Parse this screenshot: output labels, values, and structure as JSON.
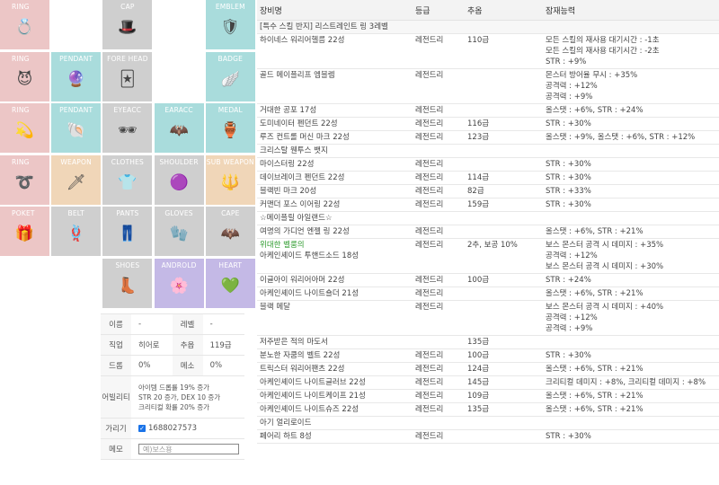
{
  "slots": [
    {
      "label": "RING",
      "icon": "ring-pink-icon",
      "glyph": "💍",
      "color": "p"
    },
    {
      "label": "",
      "icon": "",
      "glyph": "",
      "color": "blank"
    },
    {
      "label": "CAP",
      "icon": "cap-icon",
      "glyph": "🎩",
      "color": "g"
    },
    {
      "label": "",
      "icon": "",
      "glyph": "",
      "color": "blank"
    },
    {
      "label": "EMBLEM",
      "icon": "emblem-icon",
      "glyph": "🛡",
      "color": "t"
    },
    {
      "label": "RING",
      "icon": "ring-demon-icon",
      "glyph": "😈",
      "color": "p"
    },
    {
      "label": "PENDANT",
      "icon": "pendant-icon",
      "glyph": "🔮",
      "color": "t"
    },
    {
      "label": "FORE HEAD",
      "icon": "forehead-icon",
      "glyph": "🃏",
      "color": "g"
    },
    {
      "label": "",
      "icon": "",
      "glyph": "",
      "color": "blank"
    },
    {
      "label": "BADGE",
      "icon": "badge-icon",
      "glyph": "🪽",
      "color": "t"
    },
    {
      "label": "RING",
      "icon": "ring-gold-icon",
      "glyph": "💫",
      "color": "p"
    },
    {
      "label": "PENDANT",
      "icon": "pendant-gold-icon",
      "glyph": "🐚",
      "color": "t"
    },
    {
      "label": "EYEACC",
      "icon": "eye-accessory-icon",
      "glyph": "🕶",
      "color": "g"
    },
    {
      "label": "EARACC",
      "icon": "ear-accessory-icon",
      "glyph": "🦇",
      "color": "t"
    },
    {
      "label": "MEDAL",
      "icon": "medal-icon",
      "glyph": "🏺",
      "color": "t"
    },
    {
      "label": "RING",
      "icon": "ring-swirl-icon",
      "glyph": "➰",
      "color": "p"
    },
    {
      "label": "WEAPON",
      "icon": "weapon-icon",
      "glyph": "🗡",
      "color": "o"
    },
    {
      "label": "CLOTHES",
      "icon": "clothes-icon",
      "glyph": "👕",
      "color": "g"
    },
    {
      "label": "SHOULDER",
      "icon": "shoulder-icon",
      "glyph": "🟣",
      "color": "g"
    },
    {
      "label": "SUB WEAPON",
      "icon": "sub-weapon-icon",
      "glyph": "🔱",
      "color": "o"
    },
    {
      "label": "POKET",
      "icon": "pocket-icon",
      "glyph": "🎁",
      "color": "p"
    },
    {
      "label": "BELT",
      "icon": "belt-icon",
      "glyph": "🪢",
      "color": "g"
    },
    {
      "label": "PANTS",
      "icon": "pants-icon",
      "glyph": "👖",
      "color": "g"
    },
    {
      "label": "GLOVES",
      "icon": "gloves-icon",
      "glyph": "🧤",
      "color": "g"
    },
    {
      "label": "CAPE",
      "icon": "cape-icon",
      "glyph": "🦇",
      "color": "g"
    },
    {
      "label": "",
      "icon": "",
      "glyph": "",
      "color": "blank"
    },
    {
      "label": "",
      "icon": "",
      "glyph": "",
      "color": "blank"
    },
    {
      "label": "SHOES",
      "icon": "shoes-icon",
      "glyph": "👢",
      "color": "g"
    },
    {
      "label": "ANDROLD",
      "icon": "android-icon",
      "glyph": "🌸",
      "color": "v"
    },
    {
      "label": "HEART",
      "icon": "heart-icon",
      "glyph": "💚",
      "color": "v"
    }
  ],
  "info": {
    "name_k": "이름",
    "name_v": "-",
    "level_k": "레벨",
    "level_v": "-",
    "job_k": "직업",
    "job_v": "히어로",
    "star_k": "추옵",
    "star_v": "119급",
    "drop_k": "드롭",
    "drop_v": "0%",
    "meso_k": "메소",
    "meso_v": "0%",
    "ability_k": "어빌리티",
    "ability_1": "아이템 드롭률 19% 증가",
    "ability_2": "STR 20 증가, DEX 10 증가",
    "ability_3": "크리티컬 확률 20% 증가",
    "hide_k": "가리기",
    "hide_v": "1688027573",
    "memo_k": "메모",
    "memo_placeholder": "예)보스용"
  },
  "table": {
    "headers": [
      "장비명",
      "등급",
      "추옵",
      "잠재능력"
    ],
    "rows": [
      {
        "name": "[특수 스킬 반지] 리스트레인트 링 3레벨",
        "grade": "",
        "star": "",
        "pot": [],
        "group": true
      },
      {
        "name": "하이네스 워리어헬름 22성",
        "grade": "레전드리",
        "star": "110급",
        "pot": [
          "모든 스킬의 재사용 대기시간 : -1초",
          "모든 스킬의 재사용 대기시간 : -2초",
          "STR : +9%"
        ]
      },
      {
        "name": "골드 메이플리프 엠블렘",
        "grade": "레전드리",
        "star": "",
        "pot": [
          "몬스터 방어율 무시 : +35%",
          "공격력 : +12%",
          "공격력 : +9%"
        ]
      },
      {
        "name": "거대한 공포 17성",
        "grade": "레전드리",
        "star": "",
        "pot": [
          "올스탯 : +6%, STR : +24%"
        ]
      },
      {
        "name": "도미네이터 펜던트 22성",
        "grade": "레전드리",
        "star": "116급",
        "pot": [
          "STR : +30%"
        ]
      },
      {
        "name": "루즈 컨트롤 머신 마크 22성",
        "grade": "레전드리",
        "star": "123급",
        "pot": [
          "올스탯 : +9%, 올스탯 : +6%, STR : +12%"
        ]
      },
      {
        "name": "크리스탈 웬투스 뱃지",
        "grade": "",
        "star": "",
        "pot": []
      },
      {
        "name": "마이스터링 22성",
        "grade": "레전드리",
        "star": "",
        "pot": [
          "STR : +30%"
        ]
      },
      {
        "name": "데이브레이크 펜던트 22성",
        "grade": "레전드리",
        "star": "114급",
        "pot": [
          "STR : +30%"
        ]
      },
      {
        "name": "블랙빈 마크 20성",
        "grade": "레전드리",
        "star": "82급",
        "pot": [
          "STR : +33%"
        ]
      },
      {
        "name": "커맨더 포스 이어링 22성",
        "grade": "레전드리",
        "star": "159급",
        "pot": [
          "STR : +30%"
        ]
      },
      {
        "name": "☆메이플릴 아일랜드☆",
        "grade": "",
        "star": "",
        "pot": []
      },
      {
        "name": "여명의 가디언 엔젤 링 22성",
        "grade": "레전드리",
        "star": "",
        "pot": [
          "올스탯 : +6%, STR : +21%"
        ]
      },
      {
        "name": "위대한 벨룸의",
        "name2": "아케인셰이드 투핸드소드 18성",
        "grade": "레전드리",
        "star": "2추, 보공 10%",
        "pot": [
          "보스 몬스터 공격 시 데미지 : +35%",
          "공격력 : +12%",
          "보스 몬스터 공격 시 데미지 : +30%"
        ]
      },
      {
        "name": "이글아이 워리어아머 22성",
        "grade": "레전드리",
        "star": "100급",
        "pot": [
          "STR : +24%"
        ]
      },
      {
        "name": "아케인셰이드 나이트숄더 21성",
        "grade": "레전드리",
        "star": "",
        "pot": [
          "올스탯 : +6%, STR : +21%"
        ]
      },
      {
        "name": "블랙 메달",
        "grade": "레전드리",
        "star": "",
        "pot": [
          "보스 몬스터 공격 시 데미지 : +40%",
          "공격력 : +12%",
          "공격력 : +9%"
        ]
      },
      {
        "name": "저주받은 적의 마도서",
        "grade": "",
        "star": "135급",
        "pot": []
      },
      {
        "name": "분노한 자쿰의 벨트 22성",
        "grade": "레전드리",
        "star": "100급",
        "pot": [
          "STR : +30%"
        ]
      },
      {
        "name": "트릭스터 워리어팬츠 22성",
        "grade": "레전드리",
        "star": "124급",
        "pot": [
          "올스탯 : +6%, STR : +21%"
        ]
      },
      {
        "name": "아케인셰이드 나이트글러브 22성",
        "grade": "레전드리",
        "star": "145급",
        "pot": [
          "크리티컬 데미지 : +8%, 크리티컬 데미지 : +8%"
        ]
      },
      {
        "name": "아케인셰이드 나이트케이프 21성",
        "grade": "레전드리",
        "star": "109급",
        "pot": [
          "올스탯 : +6%, STR : +21%"
        ]
      },
      {
        "name": "아케인셰이드 나이트슈즈 22성",
        "grade": "레전드리",
        "star": "135급",
        "pot": [
          "올스탯 : +6%, STR : +21%"
        ]
      },
      {
        "name": "아기 얼리로이드",
        "grade": "",
        "star": "",
        "pot": []
      },
      {
        "name": "페어리 하트 8성",
        "grade": "레전드리",
        "star": "",
        "pot": [
          "STR : +30%"
        ]
      }
    ]
  }
}
